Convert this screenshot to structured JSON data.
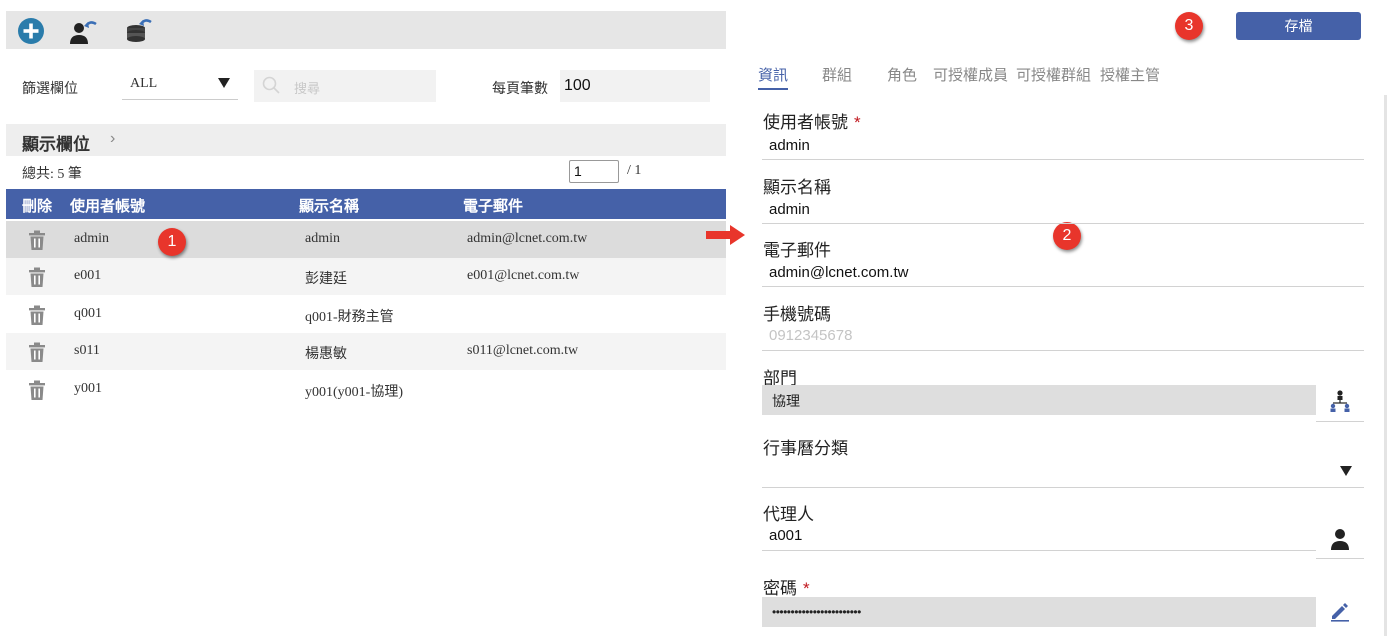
{
  "toolbar": {
    "icons": [
      "add-icon",
      "user-import-icon",
      "database-import-icon"
    ],
    "accent": "#2a7cab"
  },
  "filter": {
    "label": "篩選欄位",
    "selected": "ALL",
    "search_placeholder": "搜尋",
    "per_page_label": "每頁筆數",
    "per_page_value": "100"
  },
  "columns_bar": {
    "label": "顯示欄位",
    "chevron": "›"
  },
  "pagination": {
    "total": "總共: 5 筆",
    "page": "1",
    "pages": "/ 1"
  },
  "table": {
    "headers": [
      "刪除",
      "使用者帳號",
      "顯示名稱",
      "電子郵件"
    ],
    "rows": [
      {
        "account": "admin",
        "name": "admin",
        "email": "admin@lcnet.com.tw"
      },
      {
        "account": "e001",
        "name": "彭建廷",
        "email": "e001@lcnet.com.tw"
      },
      {
        "account": "q001",
        "name": "q001-財務主管",
        "email": ""
      },
      {
        "account": "s011",
        "name": "楊惠敏",
        "email": "s011@lcnet.com.tw"
      },
      {
        "account": "y001",
        "name": "y001(y001-協理)",
        "email": ""
      }
    ]
  },
  "badges": [
    "1",
    "2",
    "3"
  ],
  "save_label": "存檔",
  "tabs": [
    "資訊",
    "群組",
    "角色",
    "可授權成員",
    "可授權群組",
    "授權主管"
  ],
  "form": {
    "account_label": "使用者帳號",
    "required_mark": "*",
    "account_value": "admin",
    "display_label": "顯示名稱",
    "display_value": "admin",
    "email_label": "電子郵件",
    "email_value": "admin@lcnet.com.tw",
    "mobile_label": "手機號碼",
    "mobile_placeholder": "0912345678",
    "dept_label": "部門",
    "dept_value": "協理",
    "calendar_label": "行事曆分類",
    "calendar_value": "",
    "agent_label": "代理人",
    "agent_value": "a001",
    "password_label": "密碼",
    "password_value": "••••••••••••••••••••••••"
  },
  "colors": {
    "primary": "#4561a8",
    "badge": "#e8352b",
    "arrow": "#e8352b",
    "required": "#c0161d"
  }
}
